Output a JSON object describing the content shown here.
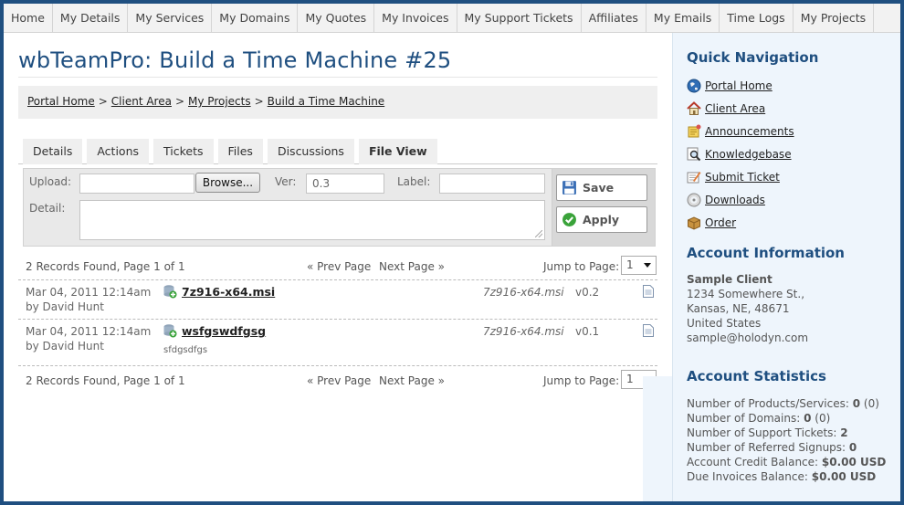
{
  "nav": [
    {
      "label": "Home"
    },
    {
      "label": "My Details"
    },
    {
      "label": "My Services"
    },
    {
      "label": "My Domains"
    },
    {
      "label": "My Quotes"
    },
    {
      "label": "My Invoices"
    },
    {
      "label": "My Support Tickets"
    },
    {
      "label": "Affiliates"
    },
    {
      "label": "My Emails"
    },
    {
      "label": "Time Logs"
    },
    {
      "label": "My Projects"
    }
  ],
  "page": {
    "title": "wbTeamPro: Build a Time Machine #25"
  },
  "breadcrumb": [
    "Portal Home",
    "Client Area",
    "My Projects",
    "Build a Time Machine"
  ],
  "breadcrumb_sep": ">",
  "tabs": [
    {
      "label": "Details"
    },
    {
      "label": "Actions"
    },
    {
      "label": "Tickets"
    },
    {
      "label": "Files"
    },
    {
      "label": "Discussions"
    },
    {
      "label": "File View",
      "active": true
    }
  ],
  "upload": {
    "upload_label": "Upload:",
    "browse_label": "Browse...",
    "ver_label": "Ver:",
    "ver_value": "0.3",
    "label_label": "Label:",
    "label_value": "",
    "detail_label": "Detail:",
    "save_label": "Save",
    "apply_label": "Apply"
  },
  "pager": {
    "count_text": "2 Records Found, Page 1 of 1",
    "prev_label": "« Prev Page",
    "next_label": "Next Page »",
    "jump_label": "Jump to Page:",
    "jump_value": "1"
  },
  "records": [
    {
      "date": "Mar 04, 2011 12:14am",
      "by": "by David Hunt",
      "name": "7z916-x64.msi",
      "desc": "",
      "original": "7z916-x64.msi",
      "version": "v0.2"
    },
    {
      "date": "Mar 04, 2011 12:14am",
      "by": "by David Hunt",
      "name": "wsfgswdfgsg",
      "desc": "sfdgsdfgs",
      "original": "7z916-x64.msi",
      "version": "v0.1"
    }
  ],
  "sidebar": {
    "quicknav_title": "Quick Navigation",
    "links": [
      {
        "label": "Portal Home",
        "icon": "globe-icon"
      },
      {
        "label": "Client Area",
        "icon": "home-icon"
      },
      {
        "label": "Announcements",
        "icon": "announcement-icon"
      },
      {
        "label": "Knowledgebase",
        "icon": "magnifier-icon"
      },
      {
        "label": "Submit Ticket",
        "icon": "ticket-icon"
      },
      {
        "label": "Downloads",
        "icon": "disc-icon"
      },
      {
        "label": "Order",
        "icon": "box-icon"
      }
    ],
    "account_title": "Account Information",
    "account": {
      "name": "Sample Client",
      "addr1": "1234 Somewhere St.,",
      "addr2": "Kansas, NE, 48671",
      "country": "United States",
      "email": "sample@holodyn.com"
    },
    "stats_title": "Account Statistics",
    "stats": [
      {
        "label": "Number of Products/Services:",
        "value": "0",
        "extra": "(0)"
      },
      {
        "label": "Number of Domains:",
        "value": "0",
        "extra": "(0)"
      },
      {
        "label": "Number of Support Tickets:",
        "value": "2",
        "extra": ""
      },
      {
        "label": "Number of Referred Signups:",
        "value": "0",
        "extra": ""
      },
      {
        "label": "Account Credit Balance:",
        "value": "$0.00 USD",
        "extra": ""
      },
      {
        "label": "Due Invoices Balance:",
        "value": "$0.00 USD",
        "extra": ""
      }
    ]
  },
  "colors": {
    "brand": "#1f4f80",
    "sidebar_bg": "#eef5fc",
    "tab_bg": "#efefef"
  }
}
